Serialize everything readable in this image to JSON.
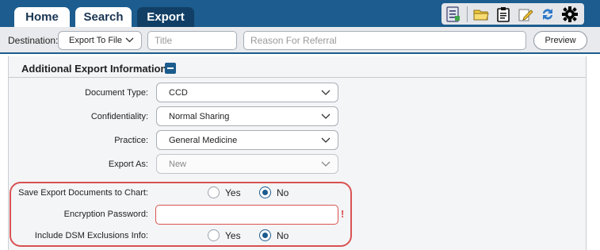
{
  "tabs": [
    {
      "label": "Home"
    },
    {
      "label": "Search"
    },
    {
      "label": "Export"
    }
  ],
  "toolbar_icons": [
    "document-list-icon",
    "folder-icon",
    "clipboard-icon",
    "edit-note-icon",
    "refresh-icon",
    "settings-gear-icon"
  ],
  "destination": {
    "label": "Destination:",
    "value": "Export To File",
    "title_placeholder": "Title",
    "reason_placeholder": "Reason For Referral",
    "preview_label": "Preview"
  },
  "section": {
    "title": "Additional Export Information"
  },
  "form": {
    "document_type": {
      "label": "Document Type:",
      "value": "CCD"
    },
    "confidentiality": {
      "label": "Confidentiality:",
      "value": "Normal Sharing"
    },
    "practice": {
      "label": "Practice:",
      "value": "General Medicine"
    },
    "export_as": {
      "label": "Export As:",
      "value": "New"
    },
    "save_to_chart": {
      "label": "Save Export Documents to Chart:",
      "yes": "Yes",
      "no": "No",
      "selected": "No"
    },
    "encryption_password": {
      "label": "Encryption Password:",
      "value": "",
      "required_mark": "!"
    },
    "include_dsm": {
      "label": "Include DSM Exclusions Info:",
      "yes": "Yes",
      "no": "No",
      "selected": "No"
    }
  },
  "colors": {
    "brand": "#1c5c8e",
    "error": "#d95252"
  }
}
